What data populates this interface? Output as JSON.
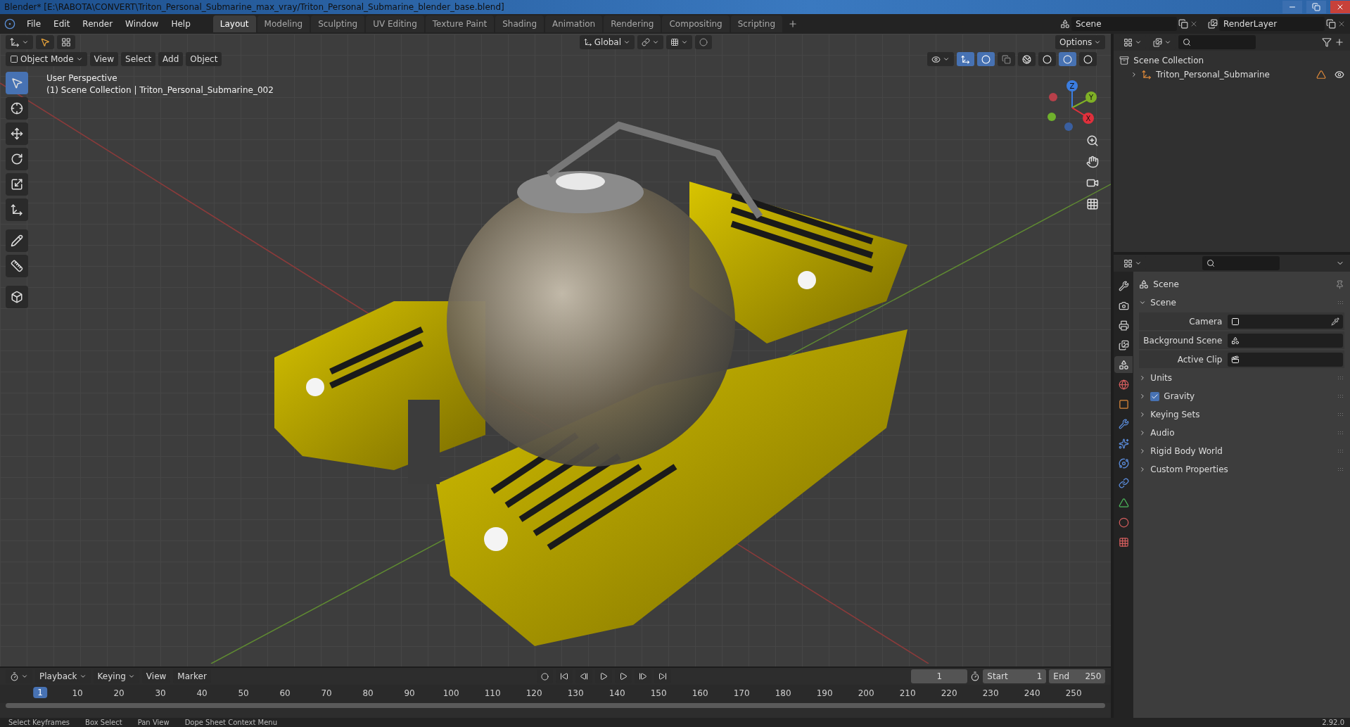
{
  "window": {
    "title": "Blender* [E:\\RABOTA\\CONVERT\\Triton_Personal_Submarine_max_vray/Triton_Personal_Submarine_blender_base.blend]"
  },
  "menu": [
    "File",
    "Edit",
    "Render",
    "Window",
    "Help"
  ],
  "workspaces": [
    {
      "label": "Layout",
      "selected": true
    },
    {
      "label": "Modeling",
      "selected": false
    },
    {
      "label": "Sculpting",
      "selected": false
    },
    {
      "label": "UV Editing",
      "selected": false
    },
    {
      "label": "Texture Paint",
      "selected": false
    },
    {
      "label": "Shading",
      "selected": false
    },
    {
      "label": "Animation",
      "selected": false
    },
    {
      "label": "Rendering",
      "selected": false
    },
    {
      "label": "Compositing",
      "selected": false
    },
    {
      "label": "Scripting",
      "selected": false
    }
  ],
  "scene_selector": {
    "value": "Scene"
  },
  "view_layer_selector": {
    "value": "RenderLayer"
  },
  "viewport": {
    "transform_orientation": "Global",
    "options": "Options",
    "mode": "Object Mode",
    "menus": [
      "View",
      "Select",
      "Add",
      "Object"
    ],
    "overlay_text": [
      "User Perspective",
      "(1) Scene Collection | Triton_Personal_Submarine_002"
    ],
    "tools": [
      {
        "kind": "select",
        "selected": true
      },
      {
        "kind": "cursor",
        "selected": false
      },
      {
        "kind": "move",
        "selected": false
      },
      {
        "kind": "rotate",
        "selected": false
      },
      {
        "kind": "scale",
        "selected": false
      },
      {
        "kind": "transform",
        "selected": false
      },
      {
        "kind": "annotate",
        "selected": false
      },
      {
        "kind": "measure",
        "selected": false
      },
      {
        "kind": "add-cube",
        "selected": false
      }
    ],
    "shading_modes": [
      {
        "kind": "wireframe",
        "selected": false
      },
      {
        "kind": "solid",
        "selected": false
      },
      {
        "kind": "material",
        "selected": true
      },
      {
        "kind": "rendered",
        "selected": false
      }
    ],
    "gizmo_axes": [
      "Z",
      "Y",
      "X"
    ]
  },
  "outliner": {
    "items": [
      {
        "label": "Scene Collection",
        "children": [
          {
            "label": "Triton_Personal_Submarine",
            "expanded": false
          }
        ]
      }
    ]
  },
  "properties": {
    "tabs": [
      {
        "kind": "tool",
        "selected": false
      },
      {
        "kind": "render",
        "selected": false
      },
      {
        "kind": "output",
        "selected": false
      },
      {
        "kind": "view-layer",
        "selected": false
      },
      {
        "kind": "scene",
        "selected": true
      },
      {
        "kind": "world",
        "selected": false
      },
      {
        "kind": "object",
        "selected": false
      },
      {
        "kind": "modifier",
        "selected": false
      },
      {
        "kind": "particles",
        "selected": false
      },
      {
        "kind": "physics",
        "selected": false
      },
      {
        "kind": "constraints",
        "selected": false
      },
      {
        "kind": "data",
        "selected": false
      },
      {
        "kind": "material",
        "selected": false
      },
      {
        "kind": "texture",
        "selected": false
      }
    ],
    "header": "Scene",
    "panel": {
      "label": "Scene",
      "expanded": true,
      "fields": [
        {
          "label": "Camera",
          "kind": "camera"
        },
        {
          "label": "Background Scene",
          "kind": "scene"
        },
        {
          "label": "Active Clip",
          "kind": "clip"
        }
      ]
    },
    "subpanels": [
      {
        "label": "Units",
        "expanded": false
      },
      {
        "label": "Gravity",
        "expanded": false,
        "checked": true
      },
      {
        "label": "Keying Sets",
        "expanded": false
      },
      {
        "label": "Audio",
        "expanded": false
      },
      {
        "label": "Rigid Body World",
        "expanded": false
      },
      {
        "label": "Custom Properties",
        "expanded": false
      }
    ]
  },
  "timeline": {
    "menus": [
      "Playback",
      "Keying",
      "View",
      "Marker"
    ],
    "current_frame": "1",
    "start_label": "Start",
    "start": "1",
    "end_label": "End",
    "end": "250",
    "ruler": [
      "1",
      "10",
      "20",
      "30",
      "40",
      "50",
      "60",
      "70",
      "80",
      "90",
      "100",
      "110",
      "120",
      "130",
      "140",
      "150",
      "160",
      "170",
      "180",
      "190",
      "200",
      "210",
      "220",
      "230",
      "240",
      "250"
    ]
  },
  "status_bar": {
    "hints": [
      "Select Keyframes",
      "Box Select",
      "Pan View",
      "Dope Sheet Context Menu"
    ],
    "version": "2.92.0"
  }
}
